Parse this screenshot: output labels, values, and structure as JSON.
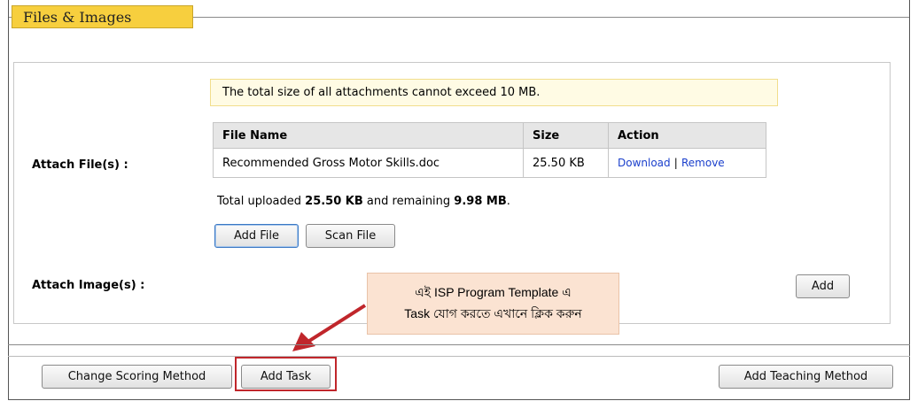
{
  "section": {
    "title": "Files & Images"
  },
  "notice": {
    "text": "The total size of all attachments cannot exceed 10 MB."
  },
  "attach_files": {
    "label": "Attach File(s) :",
    "columns": [
      "File Name",
      "Size",
      "Action"
    ],
    "rows": [
      {
        "file_name": "Recommended Gross Motor Skills.doc",
        "size": "25.50 KB",
        "download": "Download",
        "separator": "|",
        "remove": "Remove"
      }
    ],
    "summary_prefix": "Total uploaded ",
    "uploaded": "25.50 KB",
    "summary_middle": " and remaining ",
    "remaining": "9.98 MB",
    "summary_suffix": ".",
    "add_file_label": "Add File",
    "scan_file_label": "Scan File"
  },
  "attach_images": {
    "label": "Attach Image(s) :",
    "add_label": "Add"
  },
  "callout": {
    "line1": "এই ISP Program Template এ",
    "line2": "Task যোগ করতে এখানে ক্লিক   করুন"
  },
  "footer": {
    "change_scoring_label": "Change Scoring Method",
    "add_task_label": "Add Task",
    "add_teaching_label": "Add Teaching Method"
  },
  "colors": {
    "section_tab": "#f7cf3e",
    "notice_bg": "#fffbe4",
    "callout_bg": "#fbe3d2",
    "highlight": "#c0262b",
    "link": "#1a3fcc"
  }
}
